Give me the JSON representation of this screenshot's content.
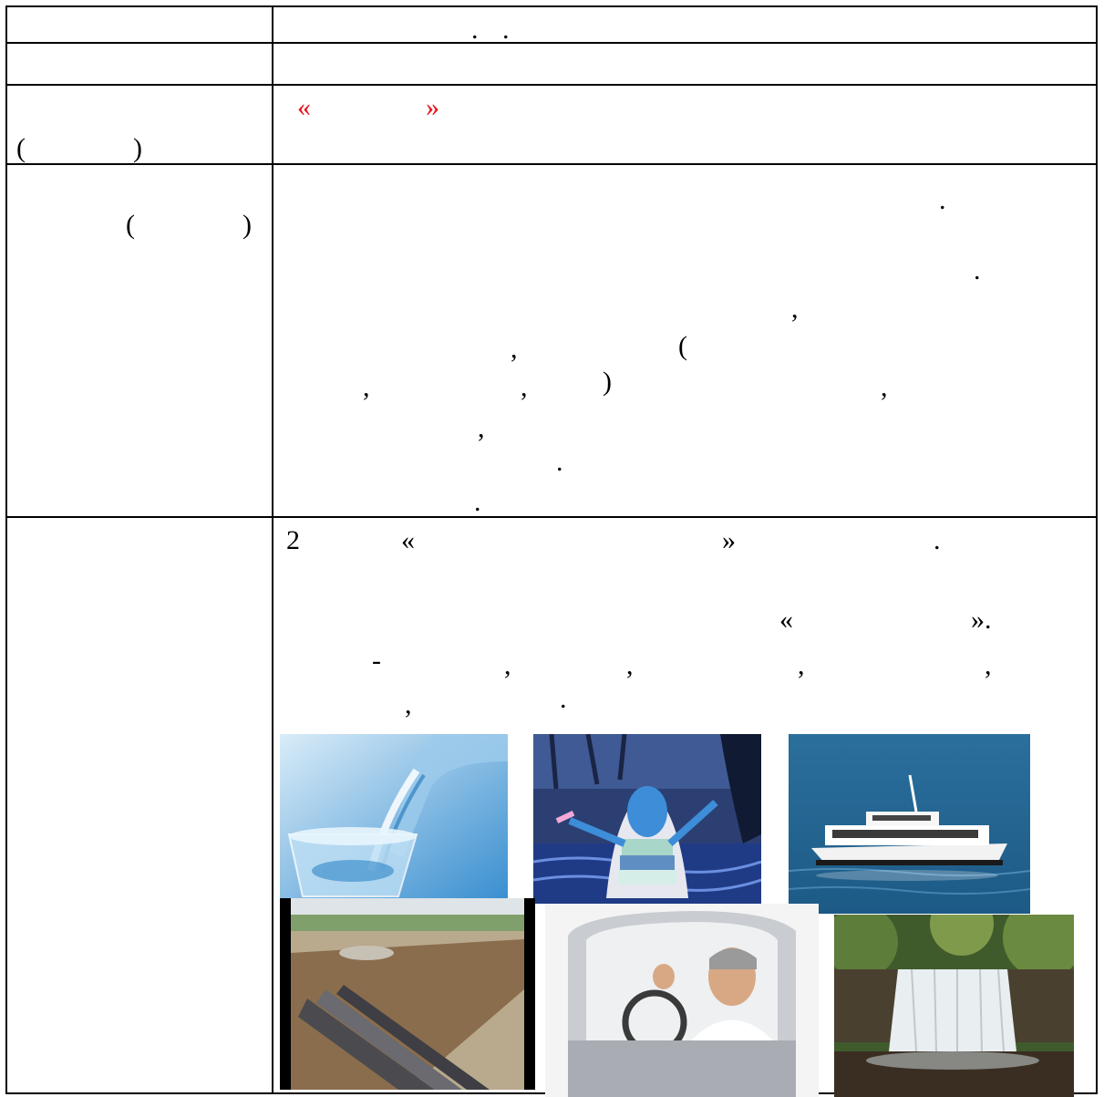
{
  "row1": {
    "right_marks": [
      ".",
      "."
    ]
  },
  "row3": {
    "left_marks": [
      "(",
      ")"
    ],
    "right_marks": [
      "«",
      "»"
    ],
    "accent_color": "#e8111a"
  },
  "row4": {
    "left_marks": [
      "(",
      ")"
    ],
    "right_marks": [
      ".",
      ".",
      ",",
      ",",
      "(",
      ",",
      ",",
      ")",
      ",",
      ",",
      ".",
      "."
    ]
  },
  "row5": {
    "line1": [
      "2",
      "«",
      "»",
      "."
    ],
    "line2": [
      "«",
      "»."
    ],
    "line3": [
      "-",
      ",",
      ",",
      ",",
      ","
    ],
    "line4": [
      ",",
      "."
    ]
  },
  "images": [
    {
      "name": "water-pouring-image"
    },
    {
      "name": "water-spirit-cartoon-image"
    },
    {
      "name": "river-boat-image"
    },
    {
      "name": "water-pipes-trench-image"
    },
    {
      "name": "man-in-car-image"
    },
    {
      "name": "waterfall-image"
    }
  ]
}
